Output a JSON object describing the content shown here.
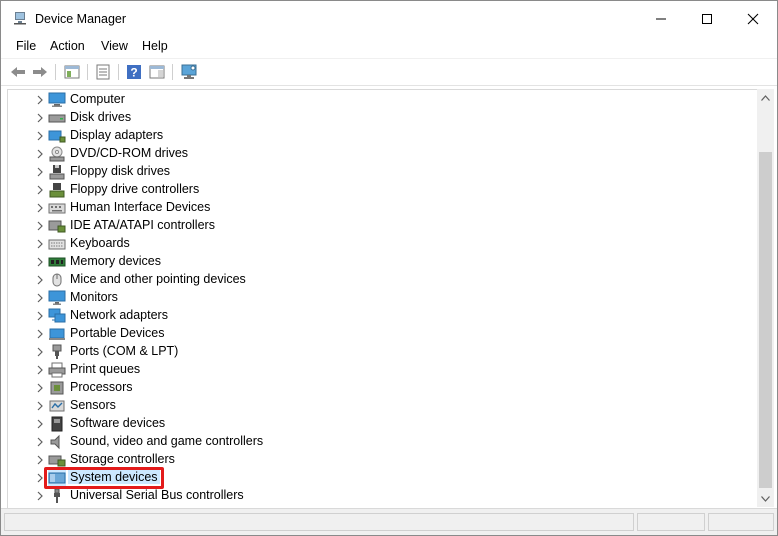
{
  "window": {
    "title": "Device Manager",
    "controls": [
      "minimize",
      "maximize",
      "close"
    ]
  },
  "menu": [
    "File",
    "Action",
    "View",
    "Help"
  ],
  "toolbar": {
    "buttons": [
      "back-arrow-icon",
      "forward-arrow-icon",
      "show-hide-tree-icon",
      "properties-icon",
      "help-icon",
      "action-pane-icon",
      "scan-hardware-icon"
    ]
  },
  "tree": {
    "items": [
      {
        "label": "Computer",
        "icon": "computer-icon"
      },
      {
        "label": "Disk drives",
        "icon": "disk-drive-icon"
      },
      {
        "label": "Display adapters",
        "icon": "display-adapter-icon"
      },
      {
        "label": "DVD/CD-ROM drives",
        "icon": "dvd-drive-icon"
      },
      {
        "label": "Floppy disk drives",
        "icon": "floppy-disk-icon"
      },
      {
        "label": "Floppy drive controllers",
        "icon": "floppy-controller-icon"
      },
      {
        "label": "Human Interface Devices",
        "icon": "hid-icon"
      },
      {
        "label": "IDE ATA/ATAPI controllers",
        "icon": "ide-controller-icon"
      },
      {
        "label": "Keyboards",
        "icon": "keyboard-icon"
      },
      {
        "label": "Memory devices",
        "icon": "memory-icon"
      },
      {
        "label": "Mice and other pointing devices",
        "icon": "mouse-icon"
      },
      {
        "label": "Monitors",
        "icon": "monitor-icon"
      },
      {
        "label": "Network adapters",
        "icon": "network-adapter-icon"
      },
      {
        "label": "Portable Devices",
        "icon": "portable-device-icon"
      },
      {
        "label": "Ports (COM & LPT)",
        "icon": "port-icon"
      },
      {
        "label": "Print queues",
        "icon": "printer-icon"
      },
      {
        "label": "Processors",
        "icon": "processor-icon"
      },
      {
        "label": "Sensors",
        "icon": "sensor-icon"
      },
      {
        "label": "Software devices",
        "icon": "software-device-icon"
      },
      {
        "label": "Sound, video and game controllers",
        "icon": "speaker-icon"
      },
      {
        "label": "Storage controllers",
        "icon": "storage-controller-icon"
      },
      {
        "label": "System devices",
        "icon": "system-devices-icon",
        "highlighted": true
      },
      {
        "label": "Universal Serial Bus controllers",
        "icon": "usb-icon"
      }
    ]
  },
  "colors": {
    "highlight_border": "#e31b1b",
    "selection_bg": "#cce8ff"
  }
}
